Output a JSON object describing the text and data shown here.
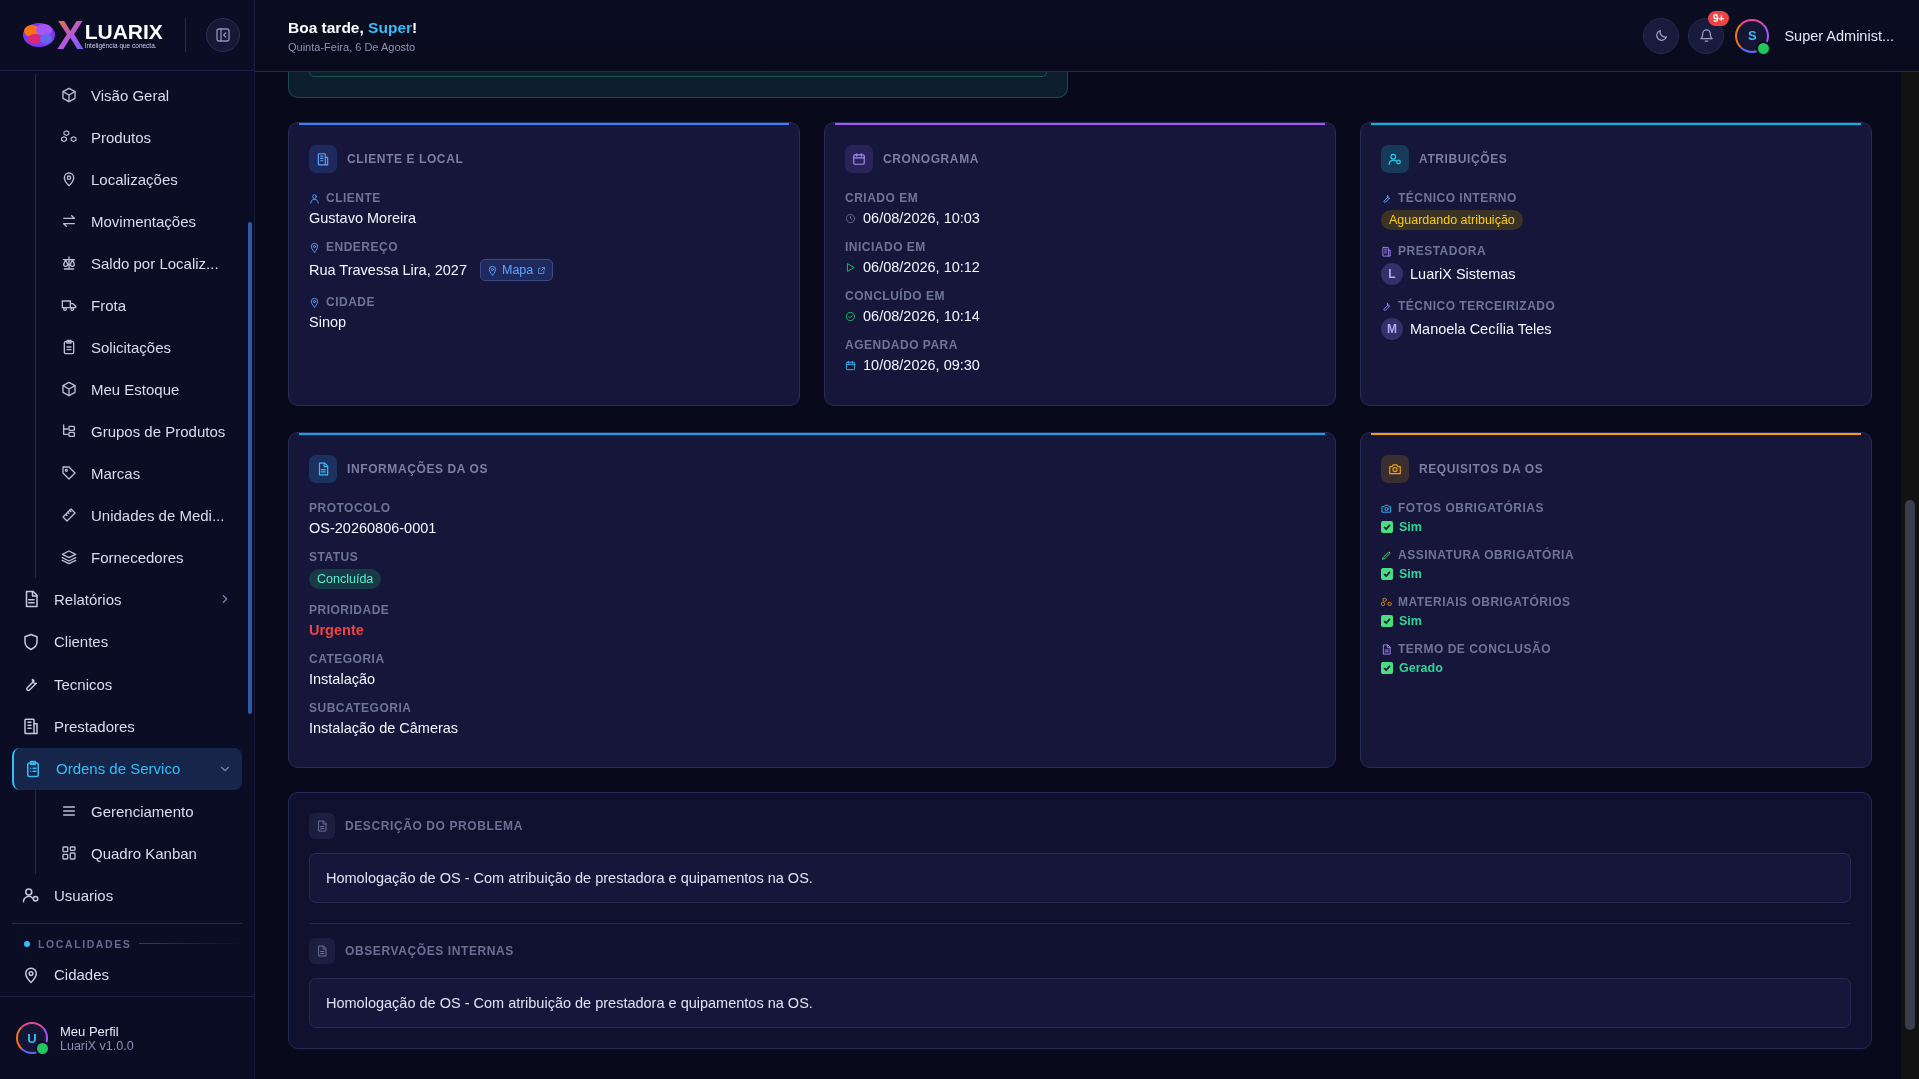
{
  "header": {
    "greeting": "Boa tarde, ",
    "user_name": "Super",
    "greeting_end": "!",
    "date": "Quinta-Feira, 6 De Agosto",
    "notifications_badge": "9+",
    "avatar": "S",
    "user": "Super Administ...",
    "online": true
  },
  "sidebar": {
    "logo": {
      "mark": "X",
      "name": "LUARIX",
      "tagline": "Inteligência que conecta."
    },
    "items": [
      {
        "kind": "open-group",
        "children": [
          {
            "label": "Visão Geral",
            "selected": false
          },
          {
            "label": "Produtos",
            "selected": false
          },
          {
            "label": "Localizações",
            "selected": false
          },
          {
            "label": "Movimentações",
            "selected": false
          },
          {
            "label": "Saldo por Localiz...",
            "selected": false
          },
          {
            "label": "Frota",
            "selected": false
          },
          {
            "label": "Solicitações",
            "selected": false
          },
          {
            "label": "Meu Estoque",
            "selected": false
          },
          {
            "label": "Grupos de Produtos",
            "selected": false
          },
          {
            "label": "Marcas",
            "selected": false
          },
          {
            "label": "Unidades de Medi...",
            "selected": false
          },
          {
            "label": "Fornecedores",
            "selected": false
          }
        ]
      },
      {
        "kind": "group",
        "label": "Relatórios",
        "selected": false,
        "expanded": false
      },
      {
        "kind": "link",
        "label": "Clientes",
        "selected": false
      },
      {
        "kind": "link",
        "label": "Tecnicos",
        "selected": false
      },
      {
        "kind": "link",
        "label": "Prestadores",
        "selected": false
      },
      {
        "kind": "group",
        "label": "Ordens de Servico",
        "selected": true,
        "expanded": true,
        "children": [
          {
            "label": "Gerenciamento",
            "selected": false
          },
          {
            "label": "Quadro Kanban",
            "selected": false
          }
        ]
      },
      {
        "kind": "link",
        "label": "Usuarios",
        "selected": false
      },
      {
        "kind": "section",
        "label": "LOCALIDADES"
      },
      {
        "kind": "link",
        "label": "Cidades",
        "selected": false
      }
    ],
    "profile": {
      "avatar": "U",
      "name": "Meu Perfil",
      "version": "LuariX v1.0.0",
      "online": true
    }
  },
  "cards": [
    {
      "title": "CLIENTE E LOCAL",
      "color": "#3b82f6",
      "fields": [
        {
          "kind": "text",
          "label": "CLIENTE",
          "value": "Gustavo Moreira"
        },
        {
          "kind": "text",
          "label": "ENDEREÇO",
          "value": "Rua Travessa Lira, 2027",
          "link": "Mapa"
        },
        {
          "kind": "text",
          "label": "CIDADE",
          "value": "Sinop"
        }
      ]
    },
    {
      "title": "CRONOGRAMA",
      "color": "#a855f7",
      "fields": [
        {
          "kind": "datetime",
          "label": "CRIADO EM",
          "value": "06/08/2026, 10:03"
        },
        {
          "kind": "datetime",
          "label": "INICIADO EM",
          "value": "06/08/2026, 10:12"
        },
        {
          "kind": "datetime",
          "label": "CONCLUÍDO EM",
          "value": "06/08/2026, 10:14"
        },
        {
          "kind": "datetime",
          "label": "AGENDADO PARA",
          "value": "10/08/2026, 09:30"
        }
      ]
    },
    {
      "title": "ATRIBUIÇÕES",
      "color": "#06b6d4",
      "fields": [
        {
          "kind": "warning",
          "label": "TÉCNICO INTERNO",
          "value": "Aguardando atribuição"
        },
        {
          "kind": "person",
          "label": "PRESTADORA",
          "avatar": "L",
          "value": "LuariX Sistemas"
        },
        {
          "kind": "person",
          "label": "TÉCNICO TERCEIRIZADO",
          "avatar": "M",
          "value": "Manoela Cecília Teles"
        }
      ]
    },
    {
      "title": "INFORMAÇÕES DA OS",
      "color": "#0ea5e9",
      "fields": [
        {
          "kind": "text",
          "label": "PROTOCOLO",
          "value": "OS-20260806-0001"
        },
        {
          "kind": "success",
          "label": "STATUS",
          "value": "Concluída"
        },
        {
          "kind": "text",
          "label": "PRIORIDADE",
          "value": "Urgente",
          "color": "#ef4444"
        },
        {
          "kind": "text",
          "label": "CATEGORIA",
          "value": "Instalação"
        },
        {
          "kind": "text",
          "label": "SUBCATEGORIA",
          "value": "Instalação de Câmeras"
        }
      ]
    },
    {
      "title": "REQUISITOS DA OS",
      "color": "#f59e0b",
      "fields": [
        {
          "kind": "requirement",
          "label": "FOTOS OBRIGATÓRIAS",
          "value": "Sim",
          "checked": true
        },
        {
          "kind": "requirement",
          "label": "ASSINATURA OBRIGATÓRIA",
          "value": "Sim",
          "checked": true
        },
        {
          "kind": "requirement",
          "label": "MATERIAIS OBRIGATÓRIOS",
          "value": "Sim",
          "checked": true
        },
        {
          "kind": "requirement",
          "label": "TERMO DE CONCLUSÃO",
          "value": "Gerado",
          "checked": true
        }
      ]
    }
  ],
  "notes": {
    "sections": [
      {
        "title": "DESCRIÇÃO DO PROBLEMA",
        "text": "Homologação de OS - Com atribuição de prestadora e quipamentos na OS."
      },
      {
        "title": "OBSERVAÇÕES INTERNAS",
        "text": "Homologação de OS - Com atribuição de prestadora e quipamentos na OS."
      }
    ]
  }
}
